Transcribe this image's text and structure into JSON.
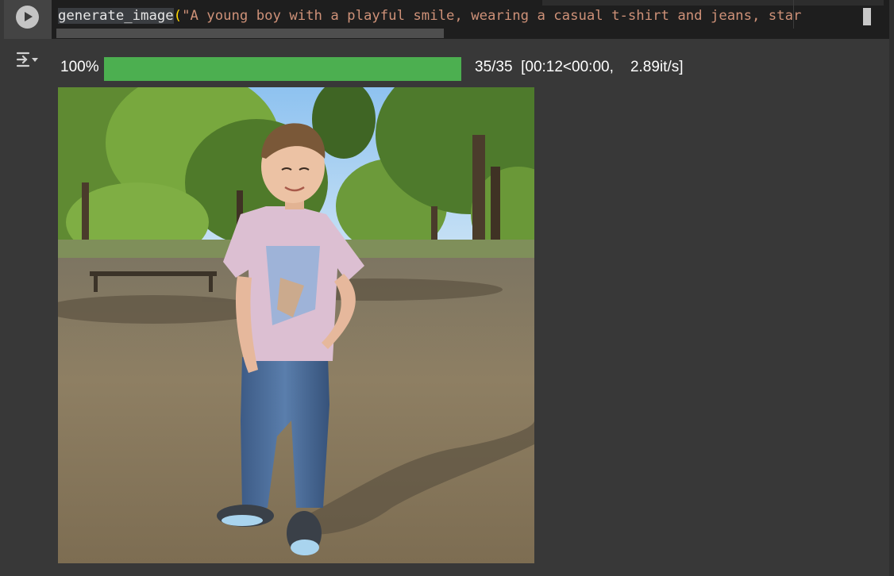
{
  "cell": {
    "code": {
      "function_name": "generate_image",
      "open_paren": "(",
      "string_literal": "\"A young boy with a playful smile, wearing a casual t-shirt and jeans, star"
    }
  },
  "output": {
    "progress": {
      "percent_label": "100%",
      "fraction": 1.0,
      "stats": "35/35  [00:12<00:00,    2.89it/s]"
    },
    "image": {
      "subject": "young boy in pink t-shirt and blue jeans standing in a park",
      "colors": {
        "sky": "#9cc8ef",
        "foliage": "#6f9a3c",
        "ground": "#8a7a5e",
        "shirt": "#d9b8cc",
        "jeans": "#3f5f8e"
      }
    }
  },
  "icons": {
    "run": "play-circle-icon",
    "output_toggle": "output-collapse-icon"
  },
  "colors": {
    "progress_fill": "#4caf50",
    "editor_bg": "#1e1e1e",
    "page_bg": "#383838"
  }
}
